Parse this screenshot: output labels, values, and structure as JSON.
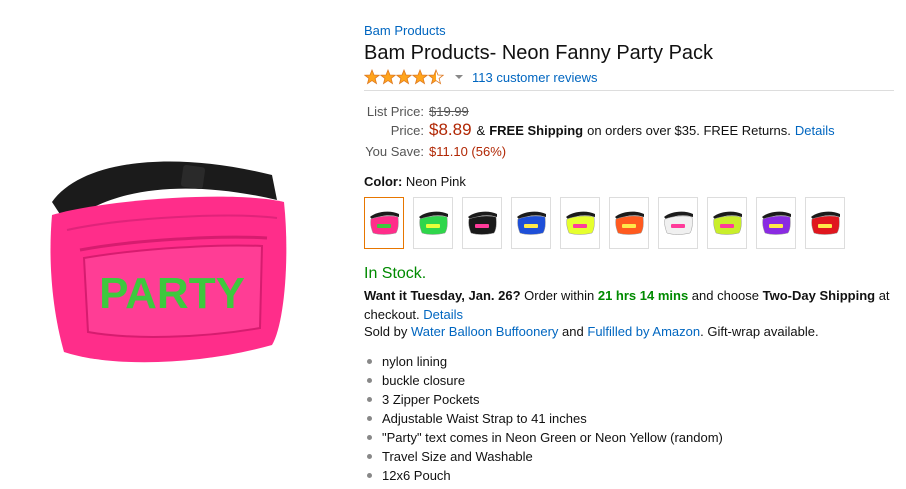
{
  "product": {
    "brand": "Bam Products",
    "title": "Bam Products- Neon Fanny Party Pack",
    "rating": 4.5,
    "reviews_text": "113 customer reviews",
    "image_text": "PARTY"
  },
  "pricing": {
    "list_label": "List Price:",
    "list_value": "$19.99",
    "price_label": "Price:",
    "price_value": "$8.89",
    "shipping_prefix": "&",
    "free_shipping": "FREE Shipping",
    "shipping_rest": "on orders over $35. FREE Returns.",
    "details_link": "Details",
    "save_label": "You Save:",
    "save_value": "$11.10 (56%)"
  },
  "color": {
    "label": "Color:",
    "selected": "Neon Pink",
    "swatches": [
      {
        "name": "Neon Pink",
        "body": "#ff2d8a",
        "text": "#3ec83e"
      },
      {
        "name": "Neon Green",
        "body": "#2fd64b",
        "text": "#e8ff3a"
      },
      {
        "name": "Black",
        "body": "#1a1a1a",
        "text": "#ff3b9a"
      },
      {
        "name": "Blue",
        "body": "#1e4fd8",
        "text": "#ffe94a"
      },
      {
        "name": "Neon Yellow",
        "body": "#e6ff2e",
        "text": "#ff3b9a"
      },
      {
        "name": "Orange",
        "body": "#ff5a1f",
        "text": "#ffe94a"
      },
      {
        "name": "White",
        "body": "#f0f0f0",
        "text": "#ff3b9a"
      },
      {
        "name": "Lime",
        "body": "#c9ee2b",
        "text": "#ff3b9a"
      },
      {
        "name": "Purple",
        "body": "#8a2be2",
        "text": "#ffe94a"
      },
      {
        "name": "Red",
        "body": "#e0161e",
        "text": "#ffe94a"
      }
    ]
  },
  "availability": {
    "stock": "In Stock.",
    "want_it": "Want it Tuesday, Jan. 26?",
    "order_within": "Order within",
    "countdown": "21 hrs 14 mins",
    "and_choose": "and choose",
    "two_day": "Two-Day Shipping",
    "at_checkout": "at checkout.",
    "details_link": "Details",
    "sold_by": "Sold by",
    "seller": "Water Balloon Buffoonery",
    "and": "and",
    "fulfilled": "Fulfilled by Amazon",
    "gift": ". Gift-wrap available."
  },
  "features": [
    "nylon lining",
    "buckle closure",
    "3 Zipper Pockets",
    "Adjustable Waist Strap to 41 inches",
    "\"Party\" text comes in Neon Green or Neon Yellow (random)",
    "Travel Size and Washable",
    "12x6 Pouch"
  ],
  "colors": {
    "link": "#0066c0",
    "price": "#b12704",
    "in_stock": "#008a00",
    "selected_border": "#e77600",
    "star": "#ffa41c"
  },
  "icons": {
    "star": "star-icon",
    "caret": "chevron-down-icon",
    "bullet": "bullet-icon"
  }
}
